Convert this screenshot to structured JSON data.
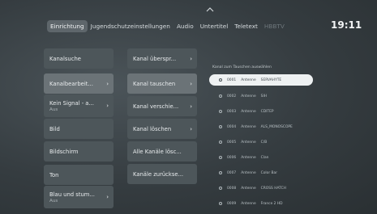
{
  "nav": {
    "tabs": [
      {
        "label": "Einrichtung"
      },
      {
        "label": "Jugendschutzeinstellungen"
      },
      {
        "label": "Audio"
      },
      {
        "label": "Untertitel"
      },
      {
        "label": "Teletext"
      },
      {
        "label": "HBBTV"
      }
    ],
    "clock": "19:11"
  },
  "menu1": [
    {
      "label": "Kanalsuche"
    },
    {
      "label": "Kanalbearbeit...",
      "arrow": "›"
    },
    {
      "label": "Kein Signal - a...",
      "sub": "Aus",
      "arrow": "›"
    },
    {
      "label": "Bild"
    },
    {
      "label": "Bildschirm"
    },
    {
      "label": "Ton"
    },
    {
      "label": "Blau und stum...",
      "sub": "Aus",
      "arrow": "›"
    }
  ],
  "menu2": [
    {
      "label": "Kanal überspr...",
      "arrow": "›"
    },
    {
      "label": "Kanal tauschen",
      "arrow": "›"
    },
    {
      "label": "Kanal verschie...",
      "arrow": "›"
    },
    {
      "label": "Kanal löschen",
      "arrow": "›"
    },
    {
      "label": "Alle Kanäle lösc..."
    },
    {
      "label": "Kanäle zurückse..."
    }
  ],
  "panel": {
    "title": "Kanal zum Tauschen auswählen",
    "channels": [
      {
        "num": "0001",
        "src": "Antenne",
        "name": "SERVAHYTE"
      },
      {
        "num": "0002",
        "src": "Antenne",
        "name": "SIH"
      },
      {
        "num": "0003",
        "src": "Antenne",
        "name": "CDITEP"
      },
      {
        "num": "0004",
        "src": "Antenne",
        "name": "ALS_MONOSCOPE"
      },
      {
        "num": "0005",
        "src": "Antenne",
        "name": "C/B"
      },
      {
        "num": "0006",
        "src": "Antenne",
        "name": "Clan"
      },
      {
        "num": "0007",
        "src": "Antenne",
        "name": "Color Bar"
      },
      {
        "num": "0008",
        "src": "Antenne",
        "name": "CROSS HATCH"
      },
      {
        "num": "0009",
        "src": "Antenne",
        "name": "France 2 HD"
      }
    ]
  }
}
